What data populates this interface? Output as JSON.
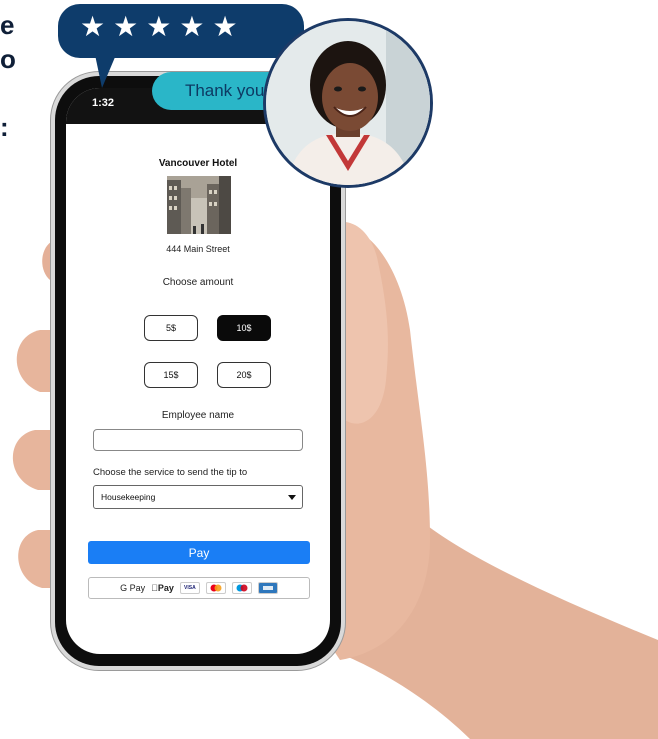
{
  "edge_text": [
    "e",
    "o",
    ":"
  ],
  "phone": {
    "status_time": "1:32"
  },
  "review": {
    "star_count": 5,
    "star_glyph": "★",
    "thank_you": "Thank you!"
  },
  "tip_form": {
    "hotel_name": "Vancouver Hotel",
    "address": "444 Main Street",
    "choose_amount_label": "Choose amount",
    "amounts": [
      "5$",
      "10$",
      "15$",
      "20$"
    ],
    "selected_amount": "10$",
    "employee_label": "Employee name",
    "employee_value": "",
    "service_label": "Choose the service to send the tip to",
    "service_selected": "Housekeeping",
    "pay_label": "Pay",
    "payment_methods": {
      "google_pay": "G Pay",
      "apple_pay": "Pay",
      "visa": "VISA"
    }
  },
  "colors": {
    "navy": "#0e3c6b",
    "teal": "#2ab6c8",
    "pay_blue": "#1a7ef5"
  }
}
